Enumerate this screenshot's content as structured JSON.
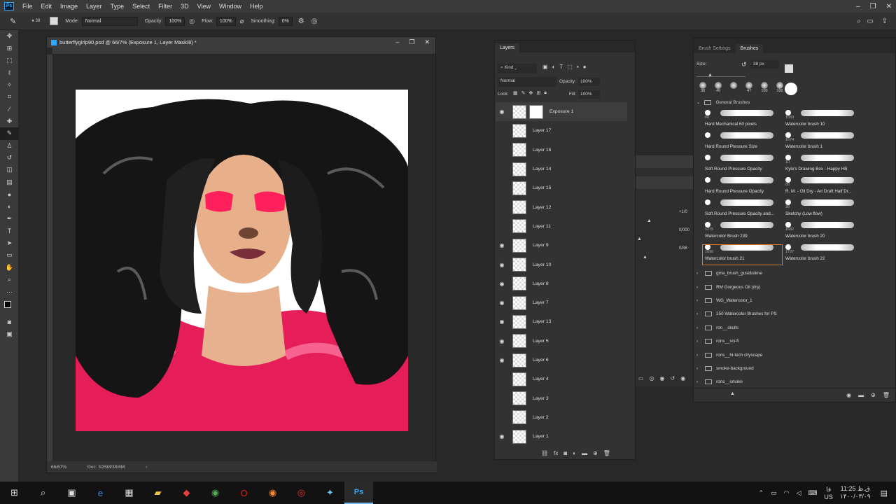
{
  "menu": {
    "logo": "Ps",
    "items": [
      "File",
      "Edit",
      "Image",
      "Layer",
      "Type",
      "Select",
      "Filter",
      "3D",
      "View",
      "Window",
      "Help"
    ]
  },
  "options": {
    "brush_size": "38",
    "mode_label": "Mode:",
    "mode_value": "Normal",
    "opacity_label": "Opacity:",
    "opacity_value": "100%",
    "flow_label": "Flow:",
    "flow_value": "100%",
    "smoothing_label": "Smoothing:",
    "smoothing_value": "0%"
  },
  "document": {
    "title": "butterflygirlp90.psd @ 66/7% (Exposure 1, Layer Mask/8) *",
    "zoom": "66/67%",
    "doc_size": "Doc: 3/35M/39/8M"
  },
  "layers_panel": {
    "tab": "Layers",
    "kind_label": "Kind",
    "blend_mode": "Normal",
    "opacity_label": "Opacity:",
    "opacity_value": "100%",
    "lock_label": "Lock:",
    "fill_label": "Fill:",
    "fill_value": "100%",
    "layers": [
      {
        "name": "Exposure 1",
        "visible": true
      },
      {
        "name": "Layer 17",
        "visible": false
      },
      {
        "name": "Layer 16",
        "visible": false
      },
      {
        "name": "Layer 14",
        "visible": false
      },
      {
        "name": "Layer 15",
        "visible": false
      },
      {
        "name": "Layer 12",
        "visible": false
      },
      {
        "name": "Layer 11",
        "visible": false
      },
      {
        "name": "Layer 9",
        "visible": true
      },
      {
        "name": "Layer 10",
        "visible": true
      },
      {
        "name": "Layer 8",
        "visible": true
      },
      {
        "name": "Layer 7",
        "visible": true
      },
      {
        "name": "Layer 13",
        "visible": true
      },
      {
        "name": "Layer 5",
        "visible": true
      },
      {
        "name": "Layer 6",
        "visible": true
      },
      {
        "name": "Layer 4",
        "visible": false
      },
      {
        "name": "Layer 3",
        "visible": false
      },
      {
        "name": "Layer 2",
        "visible": false
      },
      {
        "name": "Layer 1",
        "visible": true
      }
    ]
  },
  "behind_panel": {
    "values": [
      "+1/0",
      "0/000",
      "0/88"
    ]
  },
  "brushes_panel": {
    "tabs": [
      "Brush Settings",
      "Brushes"
    ],
    "size_label": "Size:",
    "size_value": "38 px",
    "recent_sizes": [
      "38",
      "49",
      "",
      "47",
      "100",
      "100"
    ],
    "group_name": "General Brushes",
    "brushes": [
      {
        "name": "Hard Mechanical 60 pixels",
        "size": "60"
      },
      {
        "name": "Watercolor brush 10",
        "size": "1559"
      },
      {
        "name": "Hard Round Pressure Size",
        "size": ""
      },
      {
        "name": "Watercolor brush 1",
        "size": "1674"
      },
      {
        "name": "Soft Round Pressure Opacity",
        "size": ""
      },
      {
        "name": "Kyle's Drawing Box - Happy HB",
        "size": "10"
      },
      {
        "name": "Hard Round Pressure Opacity",
        "size": ""
      },
      {
        "name": "R. M. - Oil Dry - Art Draft Half Dr...",
        "size": "80"
      },
      {
        "name": "Soft Round Pressure Opacity and...",
        "size": ""
      },
      {
        "name": "Sketchy (Low flow)",
        "size": "38"
      },
      {
        "name": "Watercolor Brush 239",
        "size": "1275"
      },
      {
        "name": "Watercolor brush 20",
        "size": "1682"
      },
      {
        "name": "Watercolor brush 21",
        "size": "1696"
      },
      {
        "name": "Watercolor brush 22",
        "size": "1727"
      }
    ],
    "folders": [
      "gma_brush_gust&slime",
      "RM Gorgeous Oil (dry)",
      "WG_Watercolor_1",
      "250 Watercolor Brushes for PS",
      "ron__skulls",
      "rons__sci-fi",
      "rons__hi-tech cityscape",
      "smoke-background",
      "rons__smoke"
    ]
  },
  "taskbar": {
    "time": "11:25 ق.ظ",
    "date": "۱۴۰۰/۰۳/۰۹",
    "lang": "US",
    "lang_alt": "فا"
  }
}
